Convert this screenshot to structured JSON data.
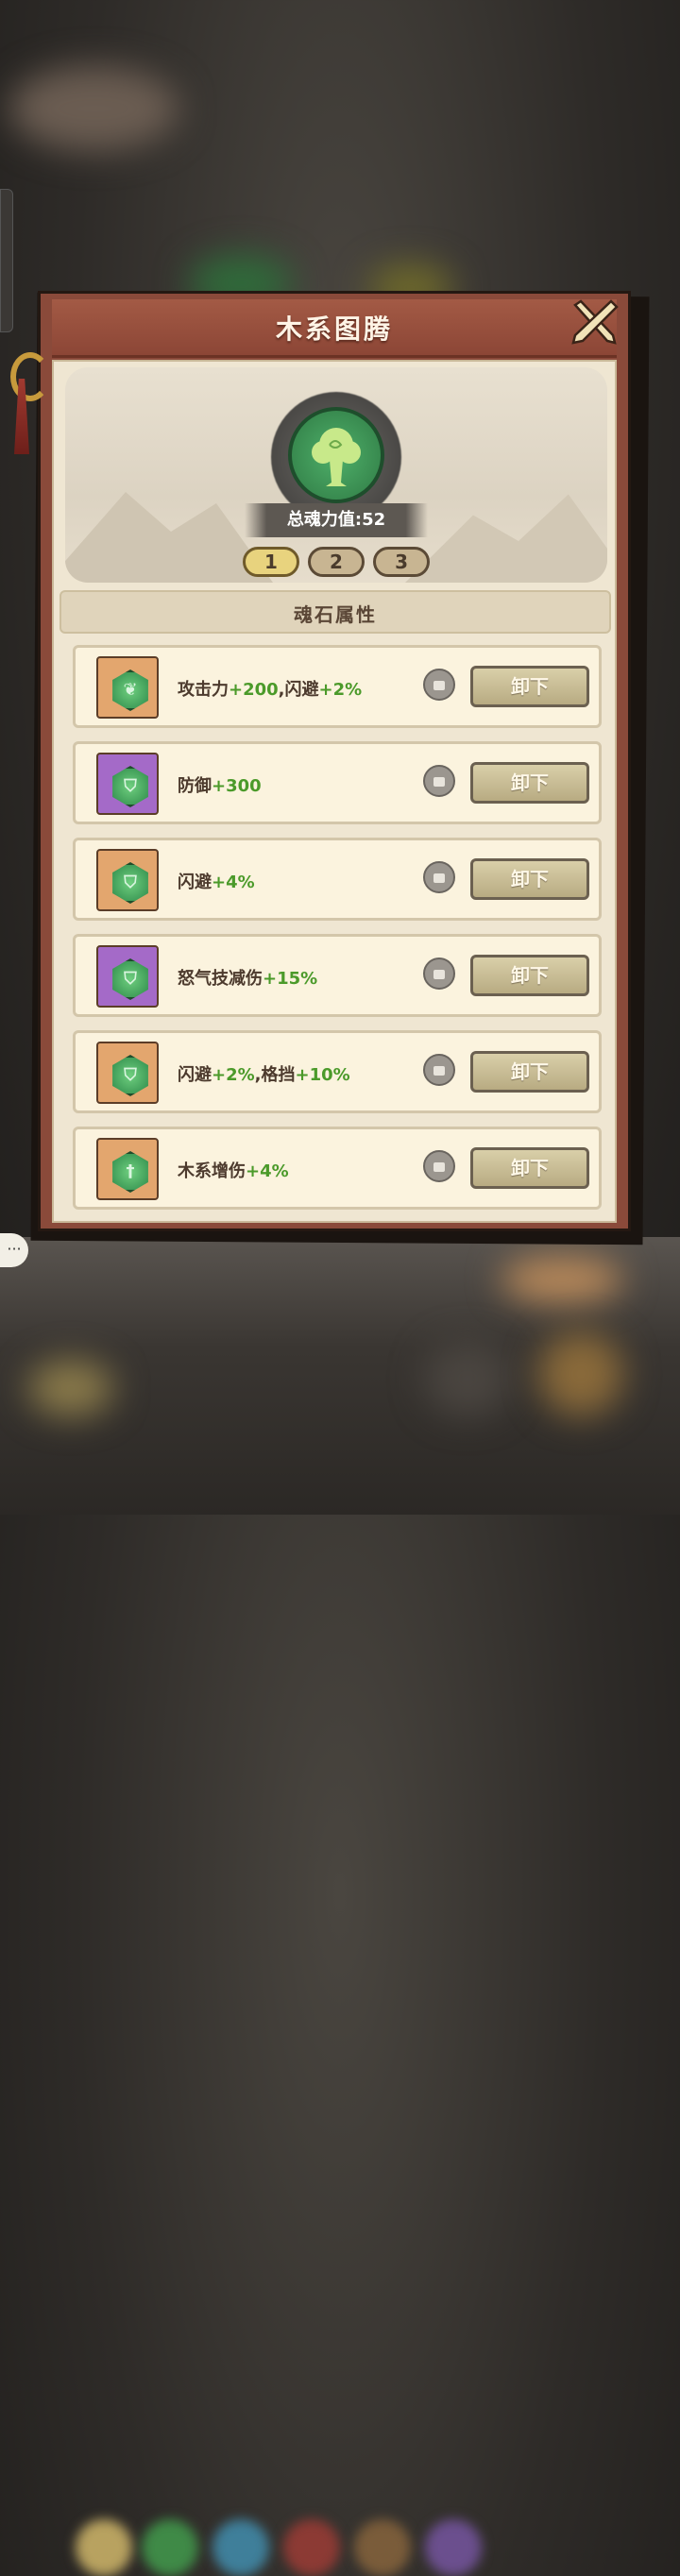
{
  "panel": {
    "title": "木系图腾",
    "soul_power": "总魂力值:52",
    "section_title": "魂石属性",
    "tabs": [
      {
        "label": "1",
        "active": true
      },
      {
        "label": "2",
        "active": false
      },
      {
        "label": "3",
        "active": false
      }
    ],
    "unload_label": "卸下",
    "items": [
      {
        "stone_color": "orange",
        "gem_icon": "swirl-icon",
        "name": "攻击力",
        "value": "+200",
        "name2": ",闪避",
        "value2": "+2%"
      },
      {
        "stone_color": "purple",
        "gem_icon": "shield-icon",
        "name": "防御",
        "value": "+300",
        "name2": "",
        "value2": ""
      },
      {
        "stone_color": "orange",
        "gem_icon": "shield-icon",
        "name": "闪避",
        "value": "+4%",
        "name2": "",
        "value2": ""
      },
      {
        "stone_color": "purple",
        "gem_icon": "shield-icon",
        "name": "怒气技减伤",
        "value": "+15%",
        "name2": "",
        "value2": ""
      },
      {
        "stone_color": "orange",
        "gem_icon": "shield-icon",
        "name": "闪避",
        "value": "+2%",
        "name2": ",格挡",
        "value2": "+10%"
      },
      {
        "stone_color": "orange",
        "gem_icon": "sword-icon",
        "name": "木系增伤",
        "value": "+4%",
        "name2": "",
        "value2": ""
      }
    ]
  },
  "colors": {
    "frame": "#8a4a3a",
    "parchment": "#efe6d2",
    "green_value": "#4b9a2a",
    "stone_orange": "#e3a66e",
    "stone_purple": "#a46ac8"
  }
}
